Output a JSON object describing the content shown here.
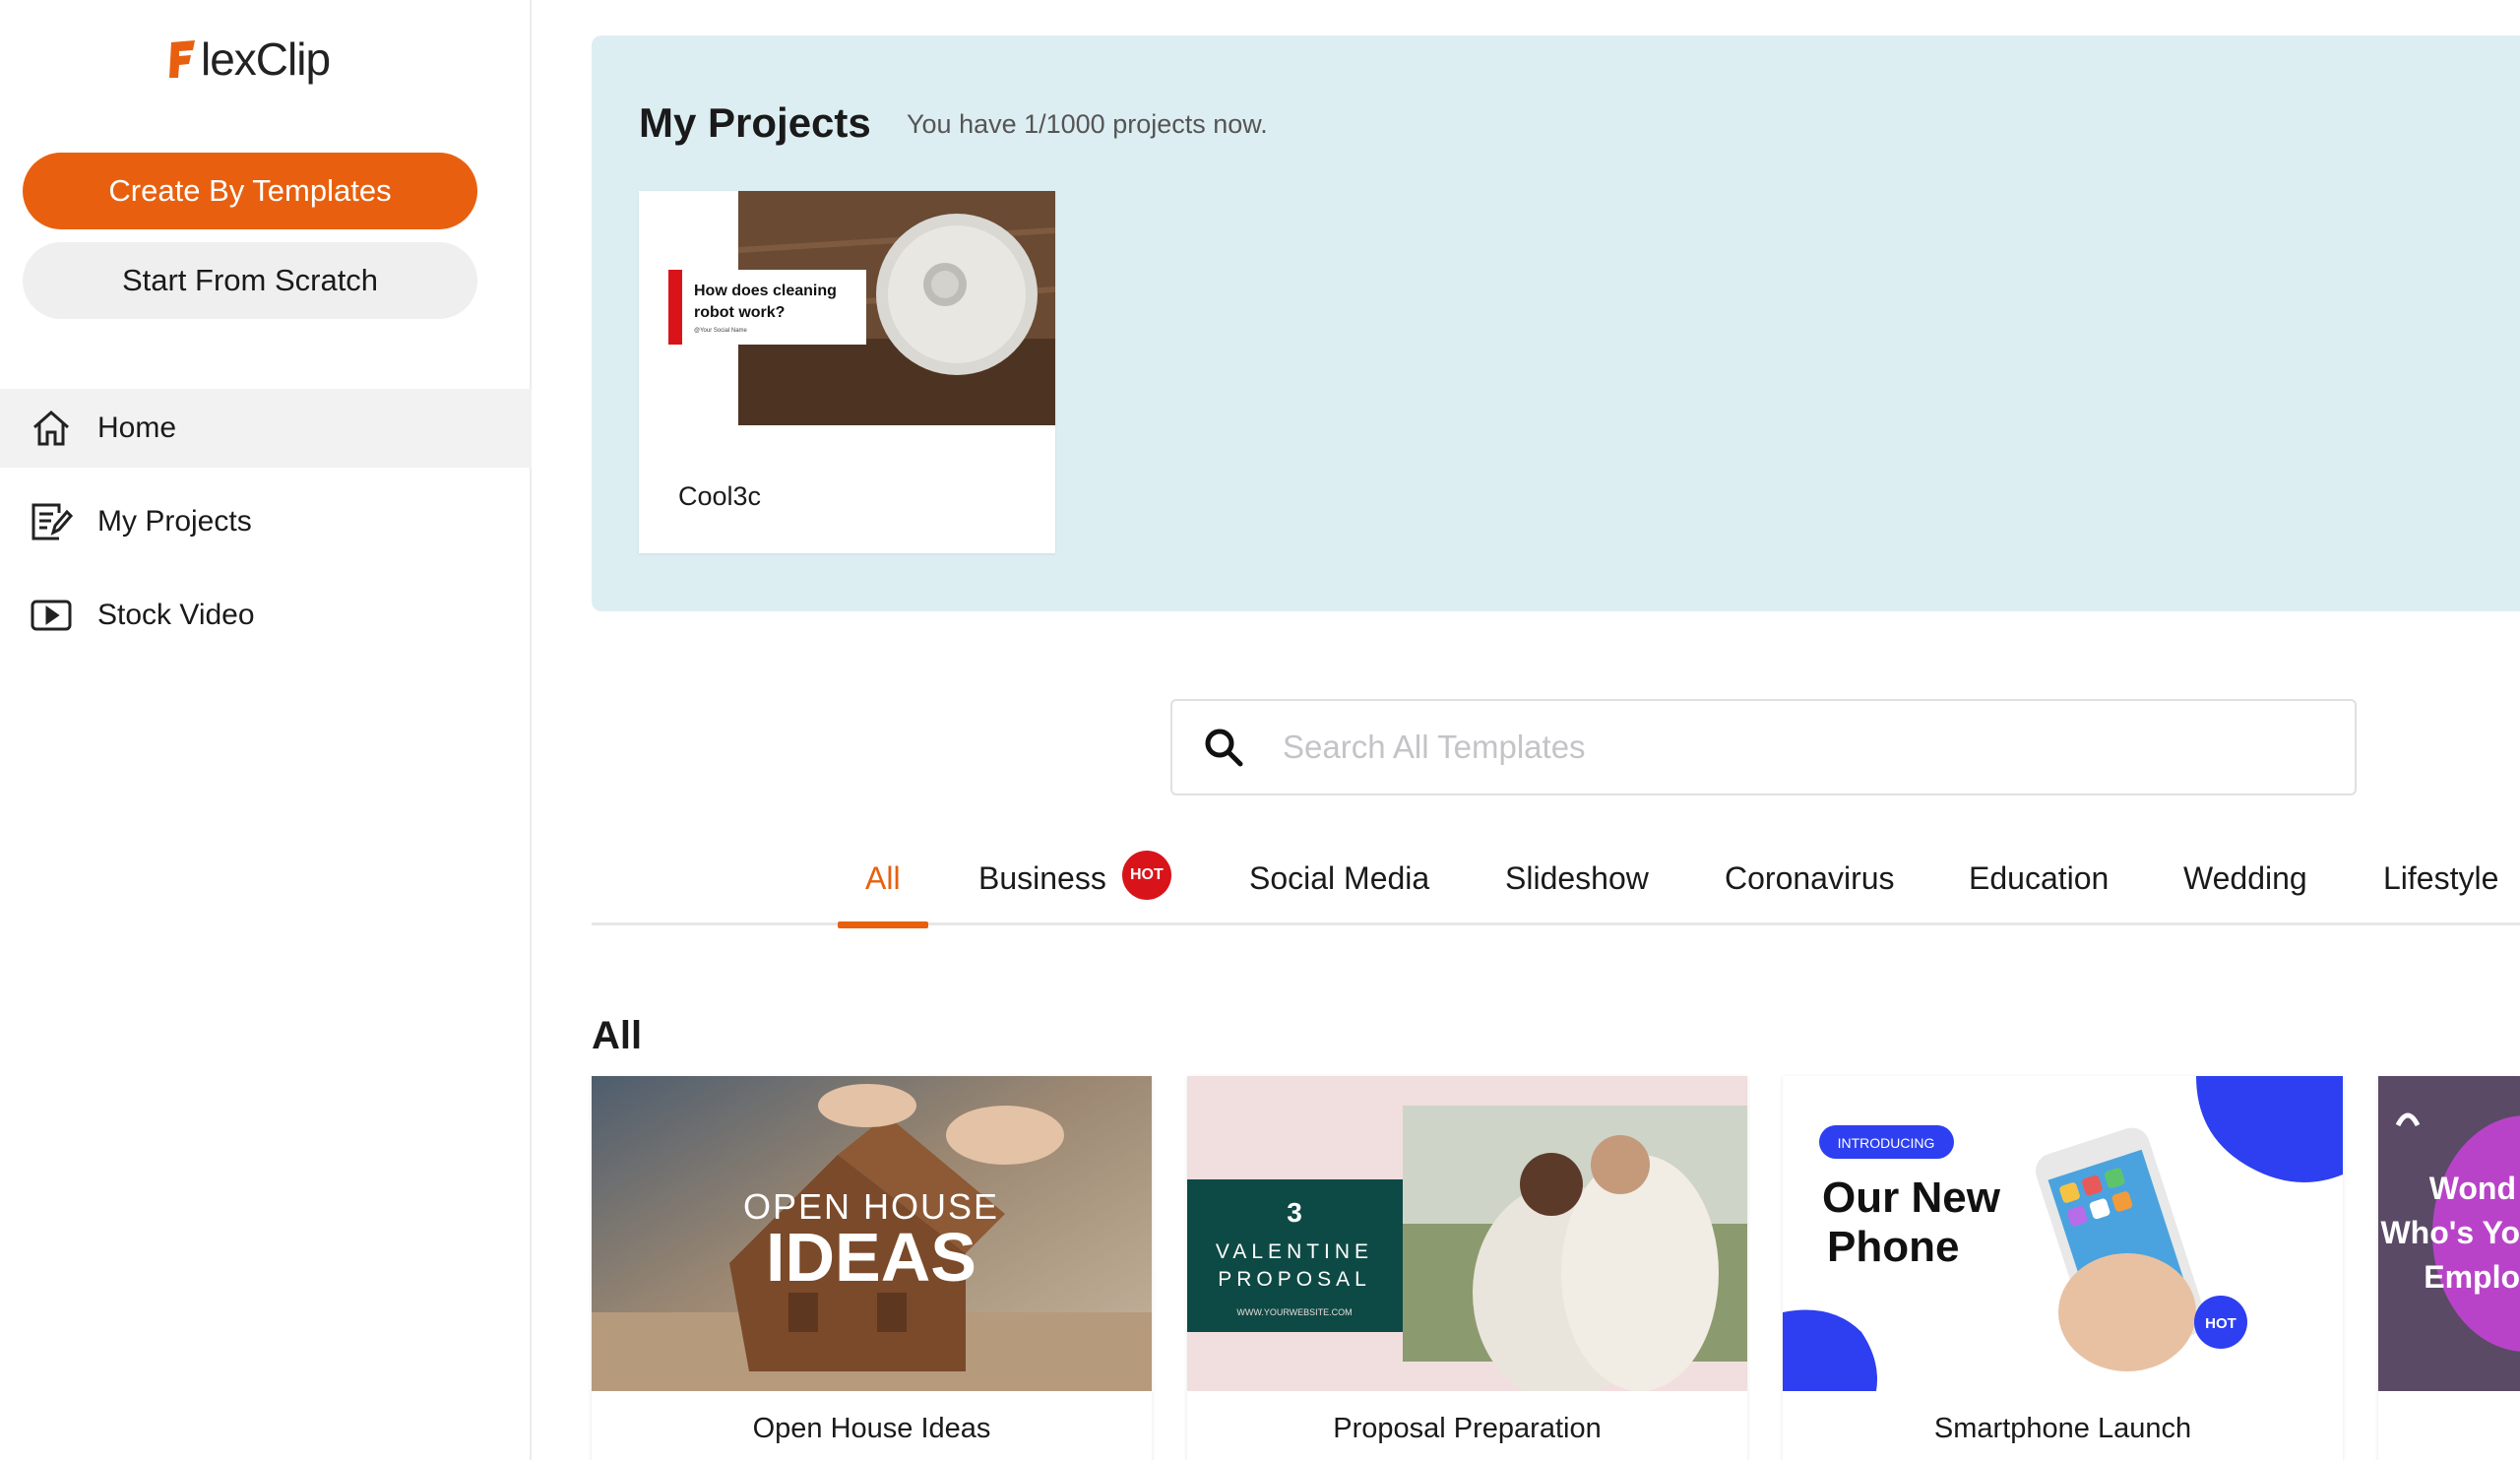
{
  "brand": {
    "name": "lexClip",
    "accent": "#e8600f"
  },
  "sidebar": {
    "create_button": "Create By Templates",
    "scratch_button": "Start From Scratch",
    "items": [
      {
        "label": "Home",
        "icon": "home-icon",
        "active": true
      },
      {
        "label": "My Projects",
        "icon": "edit-list-icon",
        "active": false
      },
      {
        "label": "Stock Video",
        "icon": "play-box-icon",
        "active": false
      }
    ]
  },
  "projects": {
    "title": "My Projects",
    "subtitle": "You have 1/1000 projects now.",
    "cards": [
      {
        "name": "Cool3c",
        "thumb_text_line1": "How does cleaning",
        "thumb_text_line2": "robot work?",
        "thumb_small": "@Your Social Name"
      }
    ]
  },
  "search": {
    "placeholder": "Search All Templates",
    "icon": "search-icon"
  },
  "tabs": [
    {
      "label": "All",
      "active": true
    },
    {
      "label": "Business",
      "badge": "HOT"
    },
    {
      "label": "Social Media"
    },
    {
      "label": "Slideshow"
    },
    {
      "label": "Coronavirus"
    },
    {
      "label": "Education"
    },
    {
      "label": "Wedding"
    },
    {
      "label": "Lifestyle"
    }
  ],
  "section_title": "All",
  "templates": [
    {
      "label": "Open House Ideas",
      "thumb_line1": "OPEN HOUSE",
      "thumb_line2": "IDEAS"
    },
    {
      "label": "Proposal Preparation",
      "thumb_line1": "3",
      "thumb_line2": "VALENTINE",
      "thumb_line3": "PROPOSAL",
      "thumb_small": "WWW.YOURWEBSITE.COM"
    },
    {
      "label": "Smartphone Launch",
      "thumb_tag": "INTRODUCING",
      "thumb_line1": "Our New",
      "thumb_line2": "Phone",
      "thumb_badge": "HOT"
    },
    {
      "label": "",
      "thumb_line1": "Wond",
      "thumb_line2": "Who's Yo",
      "thumb_line3": "Emplo"
    }
  ]
}
